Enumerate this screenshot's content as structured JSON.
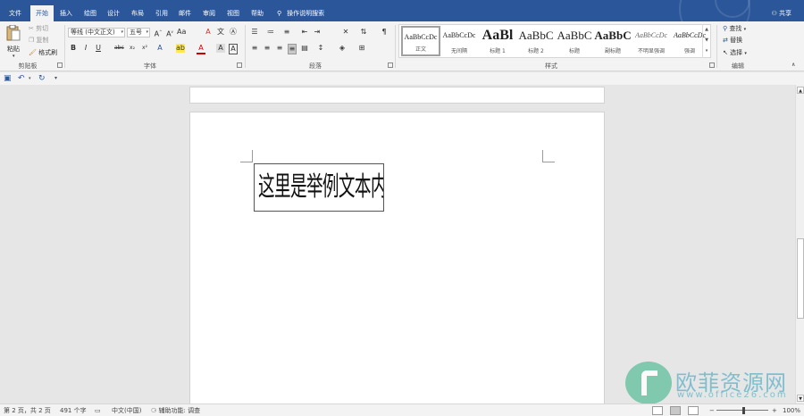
{
  "menu": {
    "tabs": [
      "文件",
      "开始",
      "插入",
      "绘图",
      "设计",
      "布局",
      "引用",
      "邮件",
      "审阅",
      "视图",
      "帮助"
    ],
    "active_tab": "开始",
    "search_label": "操作说明搜索",
    "share_label": "共享"
  },
  "ribbon": {
    "clipboard": {
      "paste": "粘贴",
      "cut": "剪切",
      "copy": "复制",
      "format_painter": "格式刷",
      "label": "剪贴板"
    },
    "font": {
      "font_name": "等线 (中文正文)",
      "font_size": "五号",
      "label": "字体"
    },
    "paragraph": {
      "label": "段落"
    },
    "styles": {
      "label": "样式",
      "items": [
        {
          "preview": "AaBbCcDc",
          "name": "正文"
        },
        {
          "preview": "AaBbCcDc",
          "name": "无间隔"
        },
        {
          "preview": "AaBl",
          "name": "标题 1"
        },
        {
          "preview": "AaBbC",
          "name": "标题 2"
        },
        {
          "preview": "AaBbC",
          "name": "标题"
        },
        {
          "preview": "AaBbC",
          "name": "副标题"
        },
        {
          "preview": "AaBbCcDc",
          "name": "不明显强调"
        },
        {
          "preview": "AaBbCcDc",
          "name": "强调"
        }
      ]
    },
    "editing": {
      "find": "查找",
      "replace": "替换",
      "select": "选择",
      "label": "编辑"
    }
  },
  "document": {
    "textbox_text": "这里是举例文本内容。"
  },
  "watermark": {
    "cn": "欧菲资源网",
    "url": "www.office26.com"
  },
  "status": {
    "page": "第 2 页，共 2 页",
    "words": "491 个字",
    "language": "中文(中国)",
    "accessibility": "辅助功能: 调查",
    "zoom": "100%"
  },
  "colors": {
    "brand": "#2b579a",
    "ribbon_bg": "#f3f3f3",
    "canvas_bg": "#e6e6e6"
  }
}
